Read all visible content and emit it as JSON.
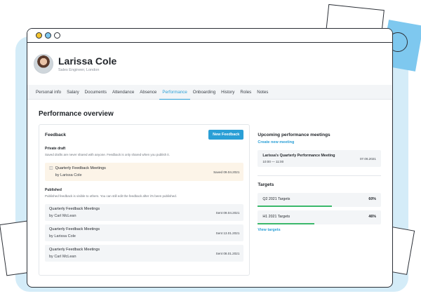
{
  "window": {
    "dots": [
      "yellow",
      "blue",
      "white"
    ]
  },
  "profile": {
    "name": "Larissa Cole",
    "role": "Sales Engineer, London"
  },
  "tabs": [
    {
      "label": "Personal info"
    },
    {
      "label": "Salary"
    },
    {
      "label": "Documents"
    },
    {
      "label": "Attendance"
    },
    {
      "label": "Absence"
    },
    {
      "label": "Performance",
      "active": true
    },
    {
      "label": "Onboarding"
    },
    {
      "label": "History"
    },
    {
      "label": "Roles"
    },
    {
      "label": "Notes"
    }
  ],
  "page_title": "Performance overview",
  "feedback": {
    "title": "Feedback",
    "new_button": "New Feedback",
    "private": {
      "label": "Private draft",
      "note": "Saved drafts are never shared with anyone. Feedback is only shared when you publish it.",
      "items": [
        {
          "title": "Quarterly Feedback Meetings",
          "by": "by Larissa Cole",
          "date": "Saved 09.04.2021"
        }
      ]
    },
    "published": {
      "label": "Published",
      "note": "Published feedback is visible to others. You can still edit the feedback after it's been published.",
      "items": [
        {
          "title": "Quarterly Feedback Meetings",
          "by": "by Carl McLean",
          "date": "Sent 09.04.2021"
        },
        {
          "title": "Quarterly Feedback Meetings",
          "by": "by Larissa Cole",
          "date": "Sent 13.01.2021"
        },
        {
          "title": "Quarterly Feedback Meetings",
          "by": "by Carl McLean",
          "date": "Sent 08.01.2021"
        }
      ]
    }
  },
  "meetings": {
    "title": "Upcoming performance meetings",
    "create_link": "Create new meeting",
    "items": [
      {
        "title": "Larissa's Quarterly Performance Meeting",
        "time": "10:00 — 11:00",
        "date": "07.06.2021"
      }
    ]
  },
  "targets": {
    "title": "Targets",
    "items": [
      {
        "label": "Q2 2021 Targets",
        "percent": "60%",
        "progress": 0.6
      },
      {
        "label": "H1 2021 Targets",
        "percent": "46%",
        "progress": 0.46
      }
    ],
    "view_link": "View targets"
  },
  "colors": {
    "accent": "#2a9fd6",
    "progress": "#3bb86b",
    "draft_bg": "#fcf4e8",
    "dot_yellow": "#f4c430",
    "dot_blue": "#7ec8ef"
  },
  "icons": {
    "draft_item": "document-icon"
  }
}
